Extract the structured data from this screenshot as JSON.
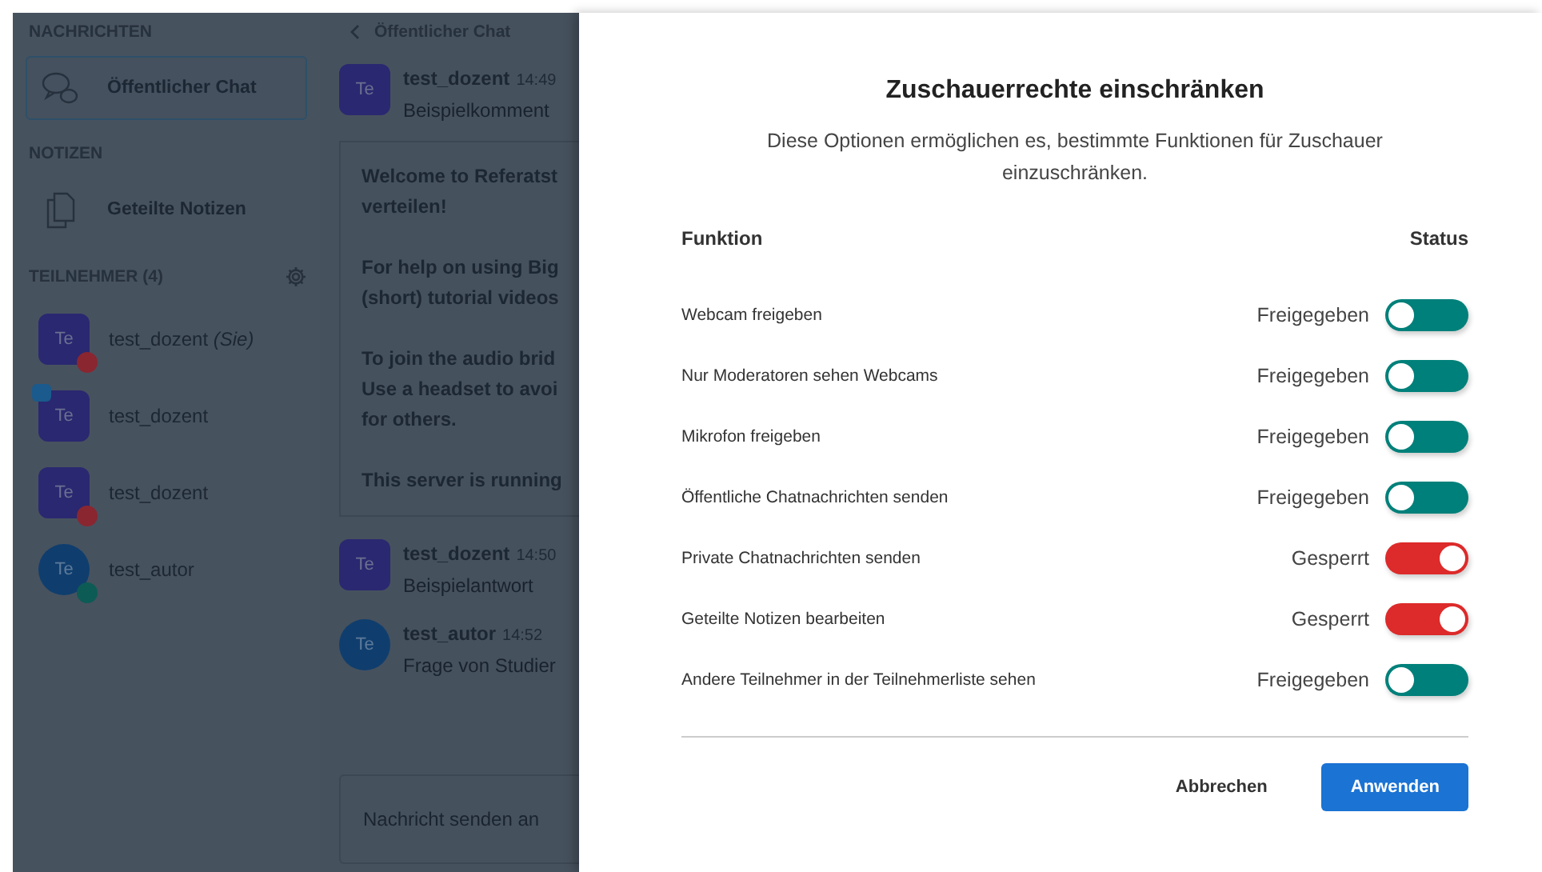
{
  "sidebar": {
    "messages_heading": "NACHRICHTEN",
    "public_chat": {
      "label": "Öffentlicher Chat",
      "selected": true
    },
    "notes_heading": "NOTIZEN",
    "shared_notes": {
      "label": "Geteilte Notizen"
    },
    "participants_heading": "TEILNEHMER (4)",
    "participants": [
      {
        "initials": "Te",
        "name": "test_dozent",
        "suffix": "(Sie)",
        "moderator": true,
        "muted": true,
        "presenter": false,
        "listen_only": false
      },
      {
        "initials": "Te",
        "name": "test_dozent",
        "moderator": true,
        "muted": false,
        "presenter": true,
        "listen_only": false
      },
      {
        "initials": "Te",
        "name": "test_dozent",
        "moderator": true,
        "muted": true,
        "presenter": false,
        "listen_only": false
      },
      {
        "initials": "Te",
        "name": "test_autor",
        "moderator": false,
        "muted": false,
        "presenter": false,
        "listen_only": true
      }
    ]
  },
  "chat": {
    "back_label": "Öffentlicher Chat",
    "messages": [
      {
        "kind": "message",
        "initials": "Te",
        "moderator": true,
        "author": "test_dozent",
        "time": "14:49",
        "text": "Beispielkomment"
      },
      {
        "kind": "welcome",
        "paragraphs": [
          [
            "Welcome to **Referatst**",
            "**verteilen**!"
          ],
          [
            "For help on using Big",
            "(short) tutorial videos"
          ],
          [
            "To join the audio brid",
            "Use a headset to avoi",
            "for others."
          ],
          [
            "This server is running"
          ]
        ]
      },
      {
        "kind": "message",
        "initials": "Te",
        "moderator": true,
        "author": "test_dozent",
        "time": "14:50",
        "text": "Beispielantwort"
      },
      {
        "kind": "message",
        "initials": "Te",
        "moderator": false,
        "author": "test_autor",
        "time": "14:52",
        "text": "Frage von Studier"
      }
    ],
    "input": {
      "placeholder": "Nachricht senden an"
    }
  },
  "modal": {
    "title": "Zuschauerrechte einschränken",
    "description": "Diese Optionen ermöglichen es, bestimmte Funktionen für Zuschauer einzuschränken.",
    "column_function": "Funktion",
    "column_status": "Status",
    "items": [
      {
        "label": "Webcam freigeben",
        "status": "Freigegeben",
        "locked": false
      },
      {
        "label": "Nur Moderatoren sehen Webcams",
        "status": "Freigegeben",
        "locked": false
      },
      {
        "label": "Mikrofon freigeben",
        "status": "Freigegeben",
        "locked": false
      },
      {
        "label": "Öffentliche Chatnachrichten senden",
        "status": "Freigegeben",
        "locked": false
      },
      {
        "label": "Private Chatnachrichten senden",
        "status": "Gesperrt",
        "locked": true
      },
      {
        "label": "Geteilte Notizen bearbeiten",
        "status": "Gesperrt",
        "locked": true
      },
      {
        "label": "Andere Teilnehmer in der Teilnehmerliste sehen",
        "status": "Freigegeben",
        "locked": false
      }
    ],
    "buttons": [
      {
        "label": "Abbrechen",
        "kind": "secondary"
      },
      {
        "label": "Anwenden",
        "kind": "primary"
      }
    ]
  }
}
